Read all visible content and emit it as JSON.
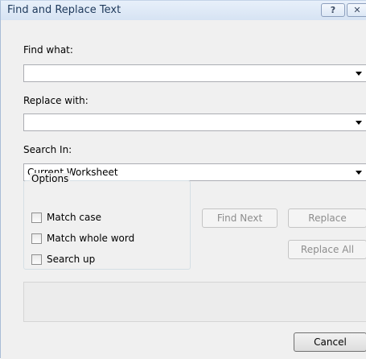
{
  "window": {
    "title": "Find and Replace Text",
    "help_glyph": "?",
    "close_glyph": "✕"
  },
  "find": {
    "label": "Find what:",
    "value": ""
  },
  "replace": {
    "label": "Replace with:",
    "value": ""
  },
  "search_in": {
    "label": "Search In:",
    "selected": "Current Worksheet"
  },
  "options": {
    "legend": "Options",
    "match_case": {
      "label": "Match case",
      "checked": false
    },
    "match_whole_word": {
      "label": "Match whole word",
      "checked": false
    },
    "search_up": {
      "label": "Search up",
      "checked": false
    }
  },
  "buttons": {
    "find_next": "Find Next",
    "replace": "Replace",
    "replace_all": "Replace All",
    "cancel": "Cancel"
  },
  "colors": {
    "title_text": "#1e395b",
    "dialog_bg": "#f0f0f0",
    "disabled_text": "#8d8d8d"
  }
}
